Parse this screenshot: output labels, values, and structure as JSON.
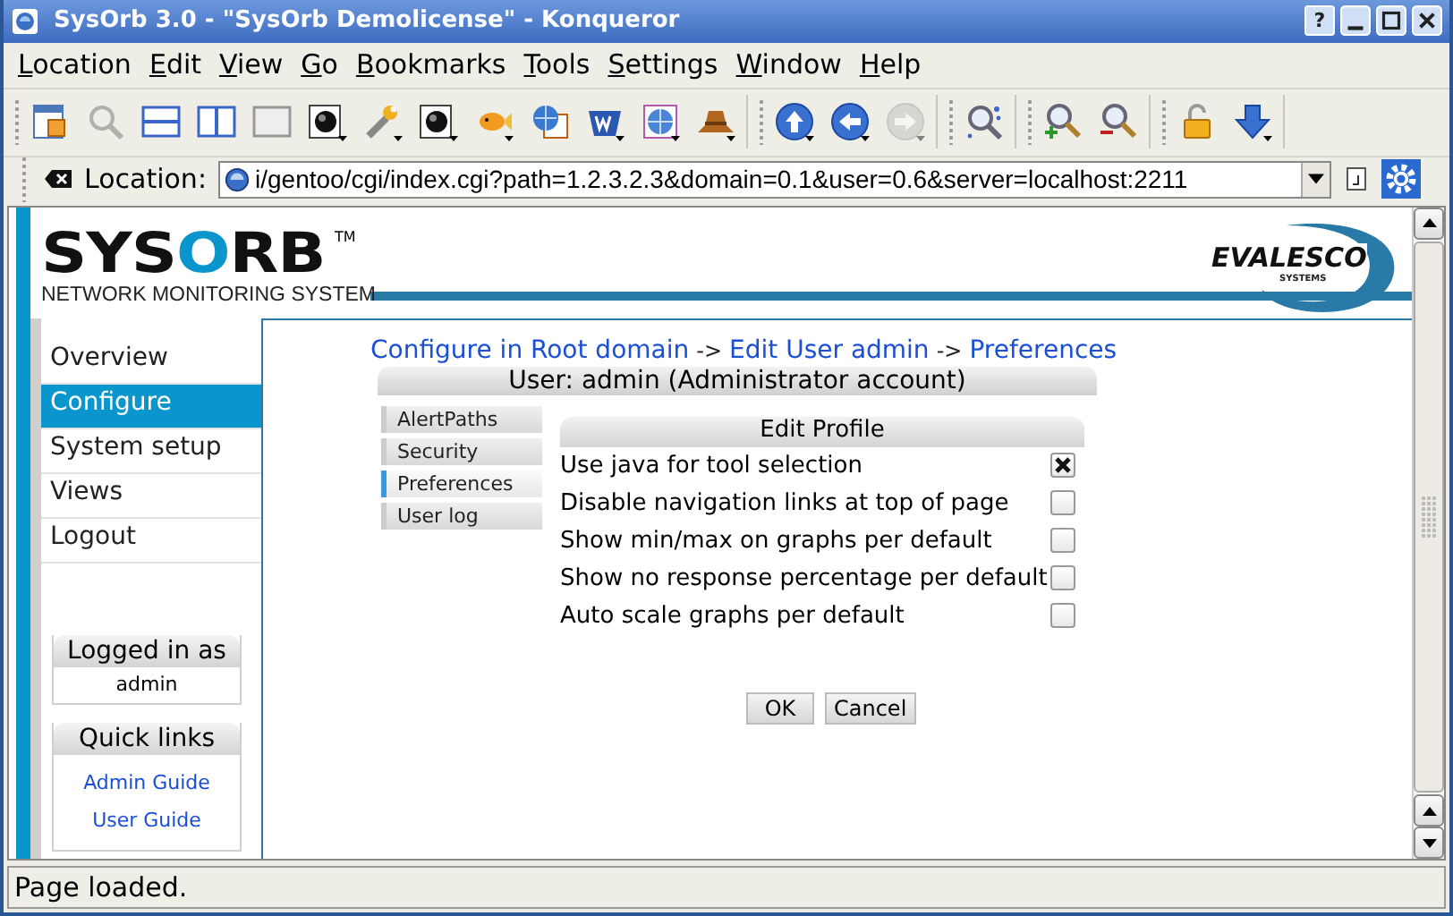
{
  "window": {
    "title": "SysOrb 3.0 - \"SysOrb Demolicense\" - Konqueror",
    "help_button": "?"
  },
  "menu": [
    {
      "label": "Location"
    },
    {
      "label": "Edit"
    },
    {
      "label": "View"
    },
    {
      "label": "Go"
    },
    {
      "label": "Bookmarks"
    },
    {
      "label": "Tools"
    },
    {
      "label": "Settings"
    },
    {
      "label": "Window"
    },
    {
      "label": "Help"
    }
  ],
  "toolbar": [
    {
      "buttons": [
        {
          "kind": "doc",
          "disabled": false,
          "menu": false
        },
        {
          "kind": "magnifier",
          "disabled": true,
          "menu": false
        },
        {
          "kind": "split-h",
          "disabled": false,
          "menu": false
        },
        {
          "kind": "split-v",
          "disabled": false,
          "menu": false
        },
        {
          "kind": "blank",
          "disabled": false,
          "menu": false
        },
        {
          "kind": "ball",
          "disabled": false,
          "menu": true
        },
        {
          "kind": "wrench",
          "disabled": false,
          "menu": true
        },
        {
          "kind": "ball",
          "disabled": false,
          "menu": true
        },
        {
          "kind": "fish",
          "disabled": false,
          "menu": true
        },
        {
          "kind": "globe-doc",
          "disabled": false,
          "menu": false
        },
        {
          "kind": "badge",
          "disabled": false,
          "menu": true
        },
        {
          "kind": "globe",
          "disabled": false,
          "menu": true
        },
        {
          "kind": "hat",
          "disabled": false,
          "menu": true
        }
      ]
    },
    {
      "buttons": [
        {
          "kind": "up",
          "disabled": false,
          "menu": true
        },
        {
          "kind": "back",
          "disabled": false,
          "menu": true
        },
        {
          "kind": "forward",
          "disabled": true,
          "menu": true
        }
      ]
    },
    {
      "buttons": [
        {
          "kind": "find",
          "disabled": false,
          "menu": false
        }
      ]
    },
    {
      "buttons": [
        {
          "kind": "zoom-in",
          "disabled": false,
          "menu": false
        },
        {
          "kind": "zoom-out",
          "disabled": false,
          "menu": false
        }
      ]
    },
    {
      "buttons": [
        {
          "kind": "lock",
          "disabled": false,
          "menu": false
        },
        {
          "kind": "download",
          "disabled": false,
          "menu": true
        }
      ]
    }
  ],
  "location_bar": {
    "label": "Location:",
    "value": "i/gentoo/cgi/index.cgi?path=1.2.3.2.3&domain=0.1&user=0.6&server=localhost:2211"
  },
  "logo": {
    "name": "SYSORB",
    "trademark": "TM",
    "tagline": "NETWORK MONITORING SYSTEM"
  },
  "partner_logo": {
    "name": "EVALESCO",
    "tagline": "SYSTEMS"
  },
  "sidebar": {
    "items": [
      {
        "label": "Overview",
        "selected": false
      },
      {
        "label": "Configure",
        "selected": true
      },
      {
        "label": "System setup",
        "selected": false
      },
      {
        "label": "Views",
        "selected": false
      },
      {
        "label": "Logout",
        "selected": false
      }
    ]
  },
  "logged_in": {
    "title": "Logged in as",
    "user": "admin"
  },
  "quick_links": {
    "title": "Quick links",
    "links": [
      "Admin Guide",
      "User Guide"
    ]
  },
  "breadcrumb": [
    {
      "kind": "link",
      "text": "Configure in Root domain"
    },
    {
      "kind": "separator",
      "text": "->"
    },
    {
      "kind": "link",
      "text": "Edit User admin"
    },
    {
      "kind": "separator",
      "text": "->"
    },
    {
      "kind": "link",
      "text": "Preferences"
    }
  ],
  "user_header": "User: admin (Administrator account)",
  "subtabs": [
    {
      "label": "AlertPaths",
      "selected": false
    },
    {
      "label": "Security",
      "selected": false
    },
    {
      "label": "Preferences",
      "selected": true
    },
    {
      "label": "User log",
      "selected": false
    }
  ],
  "profile": {
    "title": "Edit Profile",
    "options": [
      {
        "label": "Use java for tool selection",
        "checked": true
      },
      {
        "label": "Disable navigation links at top of page",
        "checked": false
      },
      {
        "label": "Show min/max on graphs per default",
        "checked": false
      },
      {
        "label": "Show no response percentage per default",
        "checked": false
      },
      {
        "label": "Auto scale graphs per default",
        "checked": false
      }
    ]
  },
  "buttons": [
    "OK",
    "Cancel"
  ],
  "status_bar": "Page loaded."
}
